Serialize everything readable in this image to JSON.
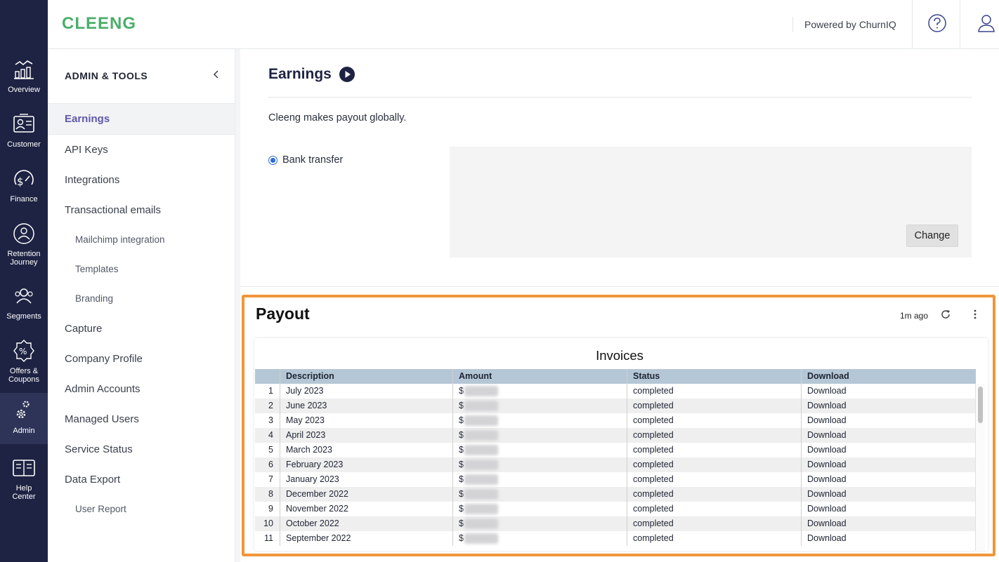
{
  "rail": {
    "items": [
      {
        "label": "Overview",
        "icon": "chart-icon"
      },
      {
        "label": "Customer",
        "icon": "customer-icon"
      },
      {
        "label": "Finance",
        "icon": "finance-icon"
      },
      {
        "label": "Retention Journey",
        "icon": "retention-icon"
      },
      {
        "label": "Segments",
        "icon": "segments-icon"
      },
      {
        "label": "Offers & Coupons",
        "icon": "offers-icon"
      },
      {
        "label": "Admin",
        "icon": "gear-icon",
        "active": true
      },
      {
        "label": "Help Center",
        "icon": "book-icon"
      }
    ]
  },
  "header": {
    "logo": "CLEENG",
    "powered_by": "Powered by ChurnIQ"
  },
  "subnav": {
    "heading": "ADMIN & TOOLS",
    "items": [
      {
        "label": "Earnings",
        "active": true
      },
      {
        "label": "API Keys"
      },
      {
        "label": "Integrations"
      },
      {
        "label": "Transactional emails"
      },
      {
        "label": "Mailchimp integration",
        "sub": true
      },
      {
        "label": "Templates",
        "sub": true
      },
      {
        "label": "Branding",
        "sub": true
      },
      {
        "label": "Capture"
      },
      {
        "label": "Company Profile"
      },
      {
        "label": "Admin Accounts"
      },
      {
        "label": "Managed Users"
      },
      {
        "label": "Service Status"
      },
      {
        "label": "Data Export"
      },
      {
        "label": "User Report",
        "sub": true
      }
    ]
  },
  "earnings": {
    "title": "Earnings",
    "description": "Cleeng makes payout globally.",
    "method_label": "Bank transfer",
    "change_label": "Change"
  },
  "payout": {
    "title": "Payout",
    "updated": "1m ago",
    "table_title": "Invoices",
    "columns": [
      "Description",
      "Amount",
      "Status",
      "Download"
    ],
    "rows": [
      {
        "n": "1",
        "description": "July 2023",
        "currency": "$",
        "status": "completed",
        "download": "Download"
      },
      {
        "n": "2",
        "description": "June 2023",
        "currency": "$",
        "status": "completed",
        "download": "Download"
      },
      {
        "n": "3",
        "description": "May 2023",
        "currency": "$",
        "status": "completed",
        "download": "Download"
      },
      {
        "n": "4",
        "description": "April 2023",
        "currency": "$",
        "status": "completed",
        "download": "Download"
      },
      {
        "n": "5",
        "description": "March 2023",
        "currency": "$",
        "status": "completed",
        "download": "Download"
      },
      {
        "n": "6",
        "description": "February 2023",
        "currency": "$",
        "status": "completed",
        "download": "Download"
      },
      {
        "n": "7",
        "description": "January 2023",
        "currency": "$",
        "status": "completed",
        "download": "Download"
      },
      {
        "n": "8",
        "description": "December 2022",
        "currency": "$",
        "status": "completed",
        "download": "Download"
      },
      {
        "n": "9",
        "description": "November 2022",
        "currency": "$",
        "status": "completed",
        "download": "Download"
      },
      {
        "n": "10",
        "description": "October 2022",
        "currency": "$",
        "status": "completed",
        "download": "Download"
      },
      {
        "n": "11",
        "description": "September 2022",
        "currency": "$",
        "status": "completed",
        "download": "Download"
      }
    ]
  },
  "colors": {
    "rail_bg": "#1e2343",
    "brand_green": "#4cae6b",
    "active_nav": "#5f58a8",
    "highlight_border": "#f0963a",
    "table_header": "#b5c7d6"
  }
}
